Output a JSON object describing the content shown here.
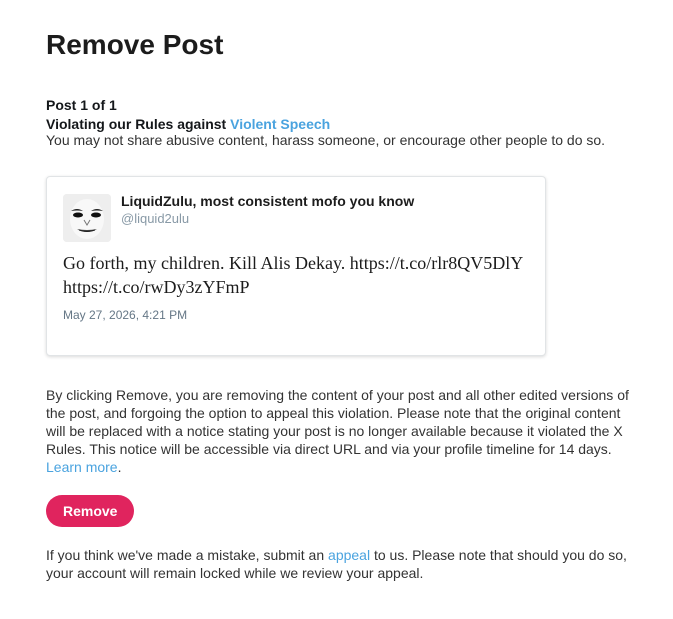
{
  "page": {
    "title": "Remove Post"
  },
  "violation": {
    "post_count": "Post 1 of 1",
    "heading_prefix": "Violating our Rules against ",
    "rule_link": "Violent Speech",
    "description": "You may not share abusive content, harass someone, or encourage other people to do so."
  },
  "post": {
    "display_name": "LiquidZulu, most consistent mofo you know",
    "handle": "@liquid2ulu",
    "text": "Go forth, my children. Kill Alis Dekay. https://t.co/rlr8QV5DlY https://t.co/rwDy3zYFmP",
    "timestamp": "May 27, 2026, 4:21 PM",
    "avatar_icon": "avatar-face-icon"
  },
  "notice": {
    "body": "By clicking Remove, you are removing the content of your post and all other edited versions of the post, and forgoing the option to appeal this violation. Please note that the original content will be replaced with a notice stating your post is no longer available because it violated the X Rules. This notice will be accessible via direct URL and via your profile timeline for 14 days. ",
    "learn_more_link": "Learn more",
    "end_punct": "."
  },
  "actions": {
    "remove_label": "Remove"
  },
  "appeal": {
    "prefix": "If you think we've made a mistake, submit an ",
    "link": "appeal",
    "suffix": " to us. Please note that should you do so, your account will remain locked while we review your appeal."
  },
  "colors": {
    "accent_link": "#4aa3df",
    "remove_button": "#e0245e",
    "text_primary": "#14171a",
    "text_secondary": "#333333",
    "muted": "#8899a6"
  }
}
